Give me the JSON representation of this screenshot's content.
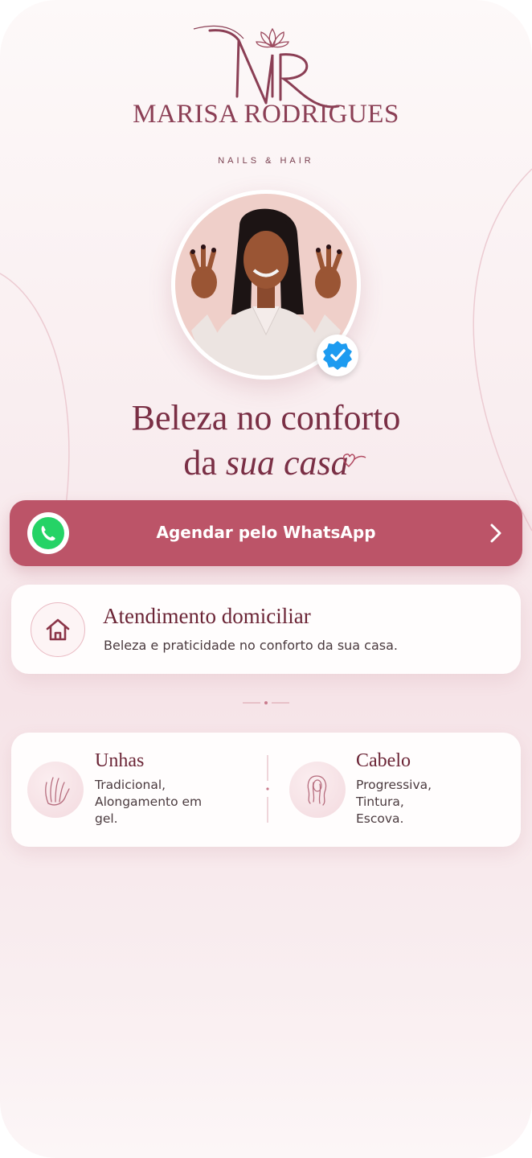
{
  "brand": {
    "monogram": "MR",
    "name": "MARISA RODRIGUES",
    "tagline": "NAILS & HAIR"
  },
  "headline": {
    "line1": "Beleza no conforto",
    "line2_regular": "da",
    "line2_italic": "sua casa"
  },
  "whatsapp_button": {
    "label": "Agendar pelo WhatsApp"
  },
  "service": {
    "title": "Atendimento domiciliar",
    "description": "Beleza e praticidade no conforto da sua casa."
  },
  "categories": [
    {
      "title": "Unhas",
      "items": [
        "Tradicional,",
        "Alongamento em",
        "gel."
      ]
    },
    {
      "title": "Cabelo",
      "items": [
        "Progressiva,",
        "Tintura,",
        "Escova."
      ]
    }
  ],
  "colors": {
    "accent": "#bc5468",
    "text_dark": "#6b2536",
    "whatsapp_green": "#25d366",
    "verified_blue": "#1d9bf0"
  }
}
